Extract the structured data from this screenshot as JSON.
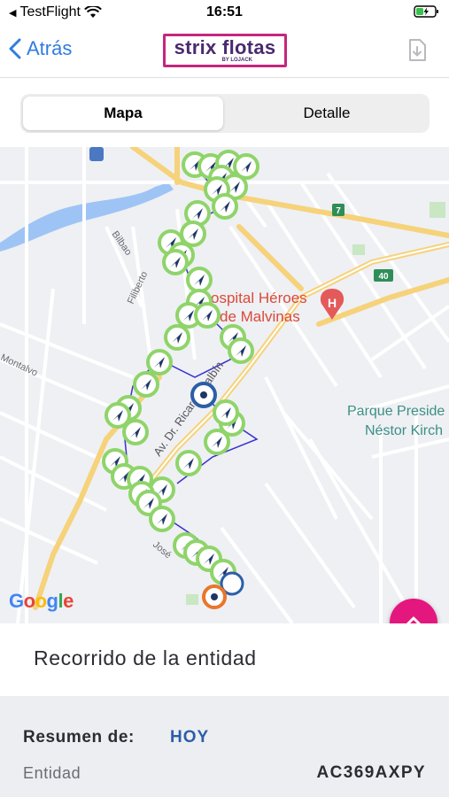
{
  "status_bar": {
    "carrier": "TestFlight",
    "time": "16:51"
  },
  "nav": {
    "back_label": "Atrás",
    "logo_text": "strix flotas",
    "logo_sub": "BY LOJACK"
  },
  "tabs": [
    {
      "label": "Mapa",
      "active": true
    },
    {
      "label": "Detalle",
      "active": false
    }
  ],
  "map": {
    "labels": {
      "hospital_line1": "ospital Héroes",
      "hospital_line2": "de Malvinas",
      "park_line1": "Parque Preside",
      "park_line2": "Néstor Kirch",
      "street_bilbao": "Bilbao",
      "street_filiberto": "Filiberto",
      "street_montalvo": "Montalvo",
      "street_avenue": "Av. Dr. Ricardo Balbín",
      "street_jose": "José",
      "route_7": "7",
      "route_40": "40",
      "hospital_marker": "H",
      "google": "Google"
    },
    "colors": {
      "road_major": "#f6d27a",
      "water": "#9ec4f5",
      "park": "#c9e7c3",
      "route_line": "#3b2fd0",
      "marker_ring": "#8fd46a",
      "marker_arrow": "#1f3566",
      "start_marker": "#2c5ea8",
      "end_marker": "#e9762b",
      "hospital_pin": "#e45a5a"
    }
  },
  "section_title": "Recorrido de la entidad",
  "summary": {
    "label": "Resumen de:",
    "value": "HOY",
    "entity_label": "Entidad",
    "entity_value": "AC369AXPY"
  },
  "colors": {
    "accent": "#2f7de1",
    "brand_magenta": "#e4177e",
    "brand_purple": "#4a2a6e"
  }
}
